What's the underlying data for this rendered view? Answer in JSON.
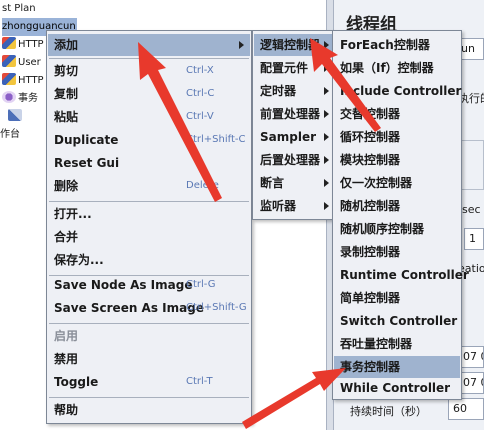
{
  "tree": {
    "plan_label": "st Plan",
    "selected_node": "zhongguancun",
    "rows": [
      "HTTP",
      "User",
      "HTTP",
      "事务",
      "",
      "作台"
    ]
  },
  "panel": {
    "title": "线程组",
    "name_value": "un",
    "action_text": "执行的",
    "num_threads_label": "sec",
    "num_threads_value": "1",
    "loop_label": "eatio",
    "start_time_value": "07 0",
    "end_time_value": "07 0",
    "duration_label": "持续时间（秒）",
    "duration_value": "60"
  },
  "context_menu": {
    "items": [
      {
        "label": "添加",
        "shortcut": "",
        "submenu": true
      },
      {
        "label": "剪切",
        "shortcut": "Ctrl-X"
      },
      {
        "label": "复制",
        "shortcut": "Ctrl-C"
      },
      {
        "label": "粘贴",
        "shortcut": "Ctrl-V"
      },
      {
        "label": "Duplicate",
        "shortcut": "Ctrl+Shift-C"
      },
      {
        "label": "Reset Gui",
        "shortcut": ""
      },
      {
        "label": "删除",
        "shortcut": "Delete"
      },
      {
        "label": "打开...",
        "shortcut": ""
      },
      {
        "label": "合并",
        "shortcut": ""
      },
      {
        "label": "保存为...",
        "shortcut": ""
      },
      {
        "label": "Save Node As Image",
        "shortcut": "Ctrl-G"
      },
      {
        "label": "Save Screen As Image",
        "shortcut": "Ctrl+Shift-G"
      },
      {
        "label": "启用",
        "shortcut": "",
        "disabled": true
      },
      {
        "label": "禁用",
        "shortcut": ""
      },
      {
        "label": "Toggle",
        "shortcut": "Ctrl-T"
      },
      {
        "label": "帮助",
        "shortcut": ""
      }
    ]
  },
  "add_submenu": {
    "items": [
      {
        "label": "逻辑控制器"
      },
      {
        "label": "配置元件"
      },
      {
        "label": "定时器"
      },
      {
        "label": "前置处理器"
      },
      {
        "label": "Sampler"
      },
      {
        "label": "后置处理器"
      },
      {
        "label": "断言"
      },
      {
        "label": "监听器"
      }
    ]
  },
  "controller_submenu": {
    "items": [
      "ForEach控制器",
      "如果（If）控制器",
      "Include Controller",
      "交替控制器",
      "循环控制器",
      "模块控制器",
      "仅一次控制器",
      "随机控制器",
      "随机顺序控制器",
      "录制控制器",
      "Runtime Controller",
      "简单控制器",
      "Switch Controller",
      "吞吐量控制器",
      "事务控制器",
      "While Controller"
    ]
  },
  "colors": {
    "highlight": "#9fb3cf",
    "arrow": "#e8392c",
    "shortcut": "#5a78b4"
  }
}
